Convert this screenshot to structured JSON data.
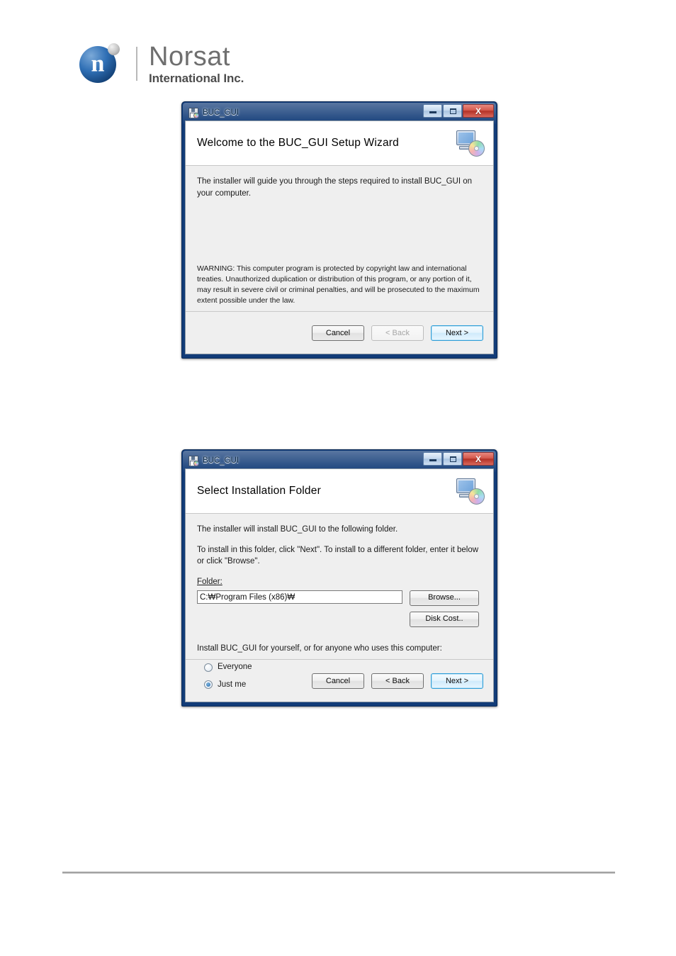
{
  "brand": {
    "logo_letter": "n",
    "name_line1": "Norsat",
    "name_line2": "International Inc."
  },
  "dialogs": [
    {
      "id": "welcome",
      "titlebar": {
        "icon": "installer-package-icon",
        "title": "BUC_GUI",
        "minimize_glyph": "",
        "maximize_glyph": "",
        "close_glyph": "X"
      },
      "header": {
        "title": "Welcome to the BUC_GUI Setup Wizard",
        "icon": "setup-monitor-cd-icon"
      },
      "body": {
        "intro": "The installer will guide you through the steps required to install BUC_GUI on your computer.",
        "warning": "WARNING: This computer program is protected by copyright law and international treaties. Unauthorized duplication or distribution of this program, or any portion of it, may result in severe civil or criminal penalties, and will be prosecuted to the maximum extent possible under the law."
      },
      "footer": {
        "cancel": "Cancel",
        "back": "< Back",
        "next": "Next >",
        "back_disabled": true
      }
    },
    {
      "id": "select-folder",
      "titlebar": {
        "icon": "installer-package-icon",
        "title": "BUC_GUI",
        "minimize_glyph": "",
        "maximize_glyph": "",
        "close_glyph": "X"
      },
      "header": {
        "title": "Select Installation Folder",
        "icon": "setup-monitor-cd-icon"
      },
      "body": {
        "line1": "The installer will install BUC_GUI to the following folder.",
        "line2": "To install in this folder, click \"Next\". To install to a different folder, enter it below or click \"Browse\".",
        "folder_label": "Folder:",
        "folder_value": "C:₩Program Files (x86)₩",
        "browse_label": "Browse...",
        "disk_cost_label": "Disk Cost..",
        "scope_text": "Install BUC_GUI for yourself, or for anyone who uses this computer:",
        "radio_everyone": "Everyone",
        "radio_just_me": "Just me",
        "selected_scope": "Just me"
      },
      "footer": {
        "cancel": "Cancel",
        "back": "< Back",
        "next": "Next >",
        "back_disabled": false
      }
    }
  ],
  "colors": {
    "aero_frame": "#123c78",
    "default_button_border": "#2f9ed8",
    "close_button": "#b33227",
    "client_background": "#efefef"
  }
}
